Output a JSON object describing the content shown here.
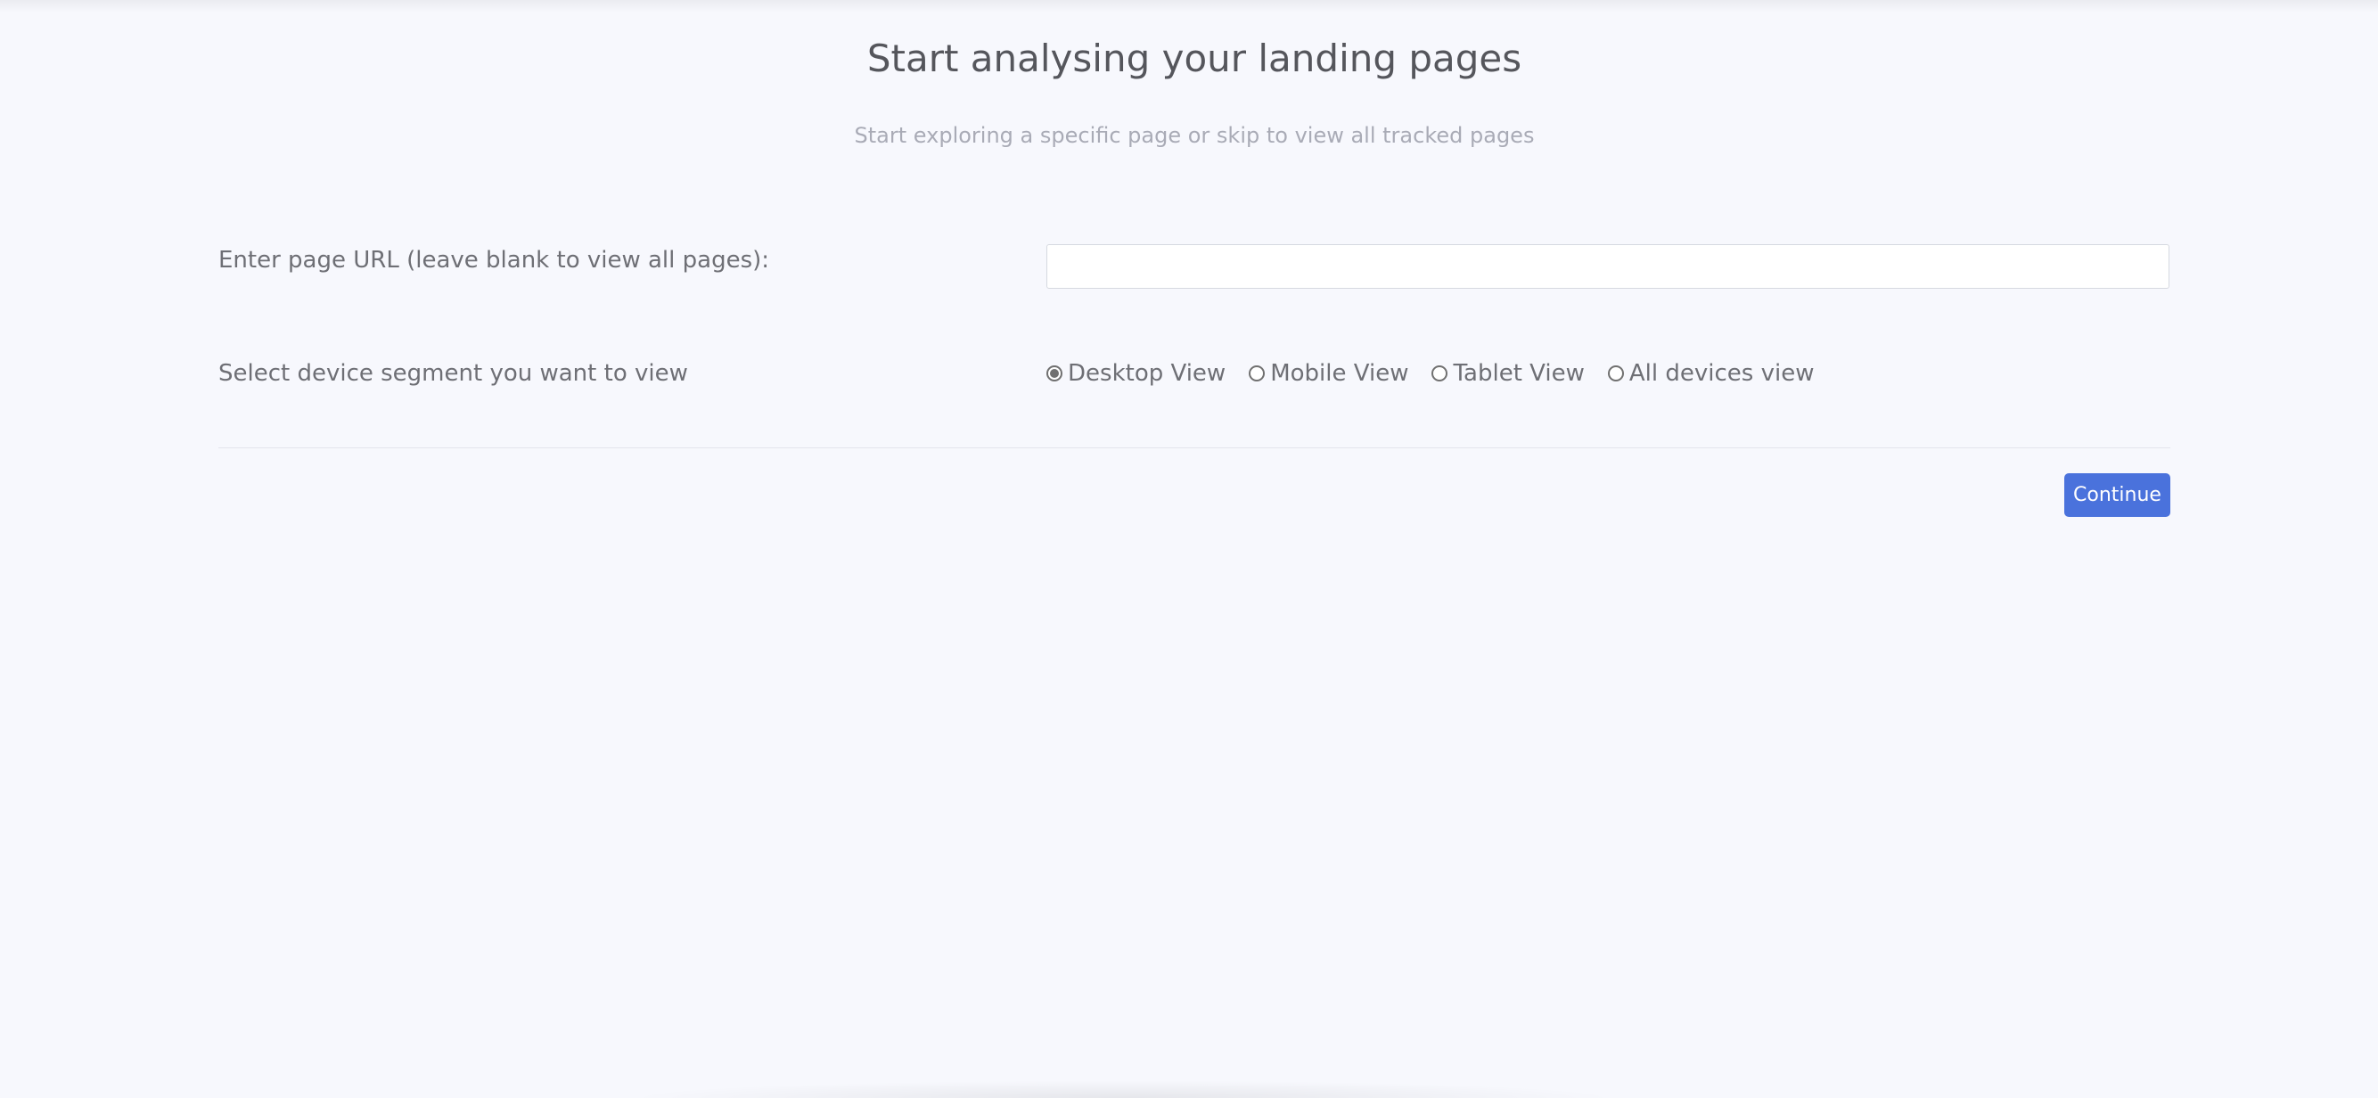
{
  "header": {
    "title": "Start analysing your landing pages",
    "subtitle": "Start exploring a specific page or skip to view all tracked pages"
  },
  "form": {
    "url_label": "Enter page URL (leave blank to view all pages):",
    "url_value": "",
    "url_placeholder": "",
    "device_label": "Select device segment you want to view",
    "device_options": [
      {
        "label": "Desktop View",
        "checked": true
      },
      {
        "label": "Mobile View",
        "checked": false
      },
      {
        "label": "Tablet View",
        "checked": false
      },
      {
        "label": "All devices view",
        "checked": false
      }
    ],
    "continue_label": "Continue"
  },
  "colors": {
    "background": "#f7f8fd",
    "accent": "#4a72dc",
    "title": "#55565c",
    "subtitle": "#a9abb6"
  }
}
